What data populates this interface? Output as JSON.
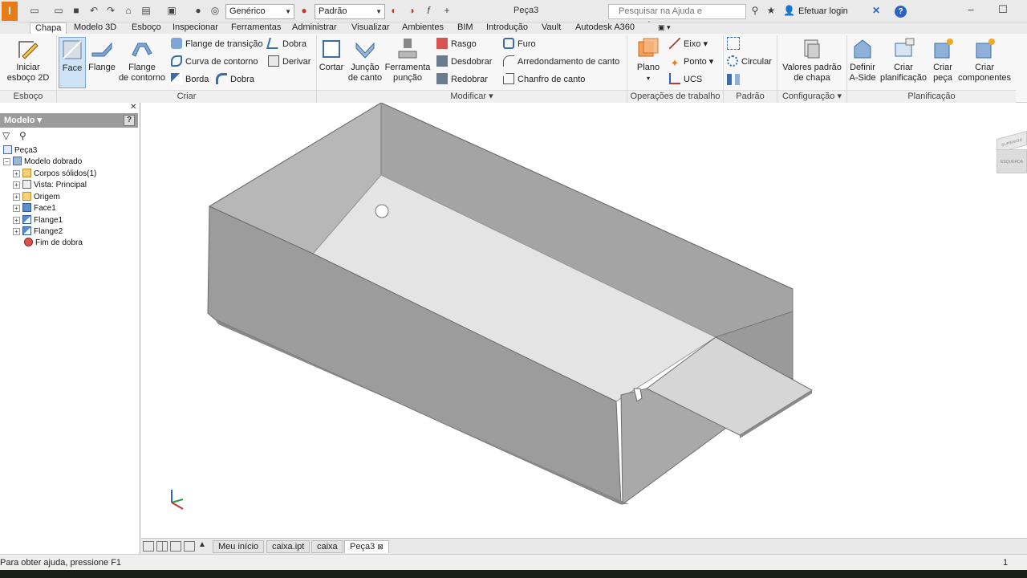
{
  "titlebar": {
    "material_combo": "Genérico",
    "appearance_combo": "Padrão",
    "doc_title": "Peça3",
    "search_placeholder": "Pesquisar na Ajuda e comandos...",
    "login": "Efetuar login",
    "help": "?"
  },
  "tabs": [
    "Chapa",
    "Modelo 3D",
    "Esboço",
    "Inspecionar",
    "Ferramentas",
    "Administrar",
    "Visualizar",
    "Ambientes",
    "BIM",
    "Introdução",
    "Vault",
    "Autodesk A360"
  ],
  "ribbon": {
    "esboco": {
      "start_sketch": "Iniciar",
      "start_sketch2": "esboço 2D",
      "label": "Esboço"
    },
    "criar": {
      "face": "Face",
      "flange": "Flange",
      "contour_flange": "Flange",
      "contour_flange2": "de contorno",
      "transition_flange": "Flange de transição",
      "contour_curve": "Curva de contorno",
      "edge": "Borda",
      "bend": "Dobra",
      "fold": "Dobra",
      "derive": "Derivar",
      "label": "Criar"
    },
    "modificar": {
      "cut": "Cortar",
      "corner_seam": "Junção",
      "corner_seam2": "de canto",
      "punch_tool": "Ferramenta",
      "punch_tool2": "punção",
      "rip": "Rasgo",
      "unfold": "Desdobrar",
      "refold": "Redobrar",
      "hole": "Furo",
      "corner_round": "Arredondamento de canto",
      "corner_chamfer": "Chanfro de canto",
      "label": "Modificar"
    },
    "workfeatures": {
      "plane": "Plano",
      "axis": "Eixo",
      "point": "Ponto",
      "ucs": "UCS",
      "label": "Operações de trabalho"
    },
    "pattern": {
      "circular": "Circular",
      "label": "Padrão"
    },
    "setup": {
      "defaults": "Valores padrão",
      "defaults2": "de chapa",
      "label": "Configuração"
    },
    "flat": {
      "define_aside": "Definir",
      "define_aside2": "A-Side",
      "create_flat": "Criar",
      "create_flat2": "planificação",
      "make_part": "Criar",
      "make_part2": "peça",
      "make_components": "Criar",
      "make_components2": "componentes",
      "label": "Planificação"
    }
  },
  "browser": {
    "title": "Modelo",
    "items": [
      "Peça3",
      "Modelo dobrado",
      "Corpos sólidos(1)",
      "Vista: Principal",
      "Origem",
      "Face1",
      "Flange1",
      "Flange2",
      "Fim de dobra"
    ]
  },
  "doc_tabs": [
    "Meu início",
    "caixa.ipt",
    "caixa",
    "Peça3"
  ],
  "status": {
    "help_text": "Para obter ajuda, pressione F1",
    "count": "1"
  },
  "viewcube": {
    "top": "SUPERIOR",
    "front": "ESQUERDA"
  },
  "colors": {
    "ribbon_bg": "#f7f7f7",
    "active_tab_border": "#bfbfbf",
    "model_face": "#a9a9a9"
  }
}
